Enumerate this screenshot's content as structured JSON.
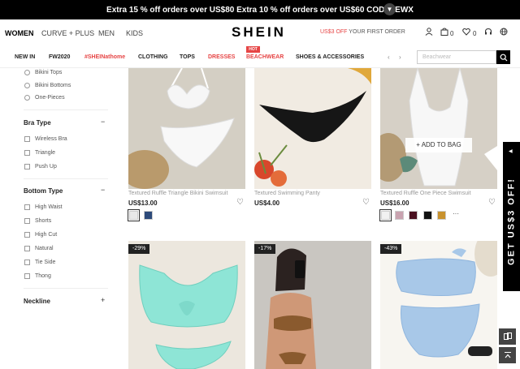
{
  "promo": {
    "text": "Extra 15 % off orders over US$80 Extra 10 % off orders over US$60 CODE: EWX",
    "chevron": "chevron-down-icon"
  },
  "header": {
    "categories": [
      "WOMEN",
      "CURVE + PLUS",
      "MEN",
      "KIDS"
    ],
    "logo": "SHEIN",
    "offer_red": "US$3 OFF",
    "offer_rest": "YOUR FIRST ORDER",
    "bag_count": "0",
    "wish_count": "0"
  },
  "catnav": {
    "items": [
      "NEW IN",
      "FW2020",
      "#SHEINathome",
      "CLOTHING",
      "TOPS",
      "DRESSES",
      "BEACHWEAR",
      "SHOES & ACCESSORIES"
    ],
    "hot": "HOT",
    "search_placeholder": "Beachwear"
  },
  "sidebar": {
    "top_options": [
      "Bikini Tops",
      "Bikini Bottoms",
      "One-Pieces"
    ],
    "sections": [
      {
        "title": "Bra Type",
        "toggle": "−",
        "options": [
          "Wireless Bra",
          "Triangle",
          "Push Up"
        ]
      },
      {
        "title": "Bottom Type",
        "toggle": "−",
        "options": [
          "High Waist",
          "Shorts",
          "High Cut",
          "Natural",
          "Tie Side",
          "Thong"
        ]
      },
      {
        "title": "Neckline",
        "toggle": "+",
        "options": []
      }
    ]
  },
  "products": [
    {
      "title": "Textured Ruffle Triangle Bikini Swimsuit",
      "price": "US$13.00",
      "swatches": [
        "#e8e8e8",
        "#2d4a7a"
      ]
    },
    {
      "title": "Textured Swimming Panty",
      "price": "US$4.00",
      "swatches": []
    },
    {
      "title": "Textured Ruffle One Piece Swimsuit",
      "price": "US$16.00",
      "swatches": [
        "#f1f1f1",
        "#c9a3b0",
        "#4a1020",
        "#111111",
        "#c8922e"
      ],
      "more": "···",
      "add_to_bag": "+ ADD TO BAG"
    },
    {
      "discount": "-29%"
    },
    {
      "discount": "-17%"
    },
    {
      "discount": "-43%"
    }
  ],
  "promo_tab": "GET US$3 OFF!",
  "colors": {
    "accent_red": "#e64545",
    "black": "#000000"
  }
}
